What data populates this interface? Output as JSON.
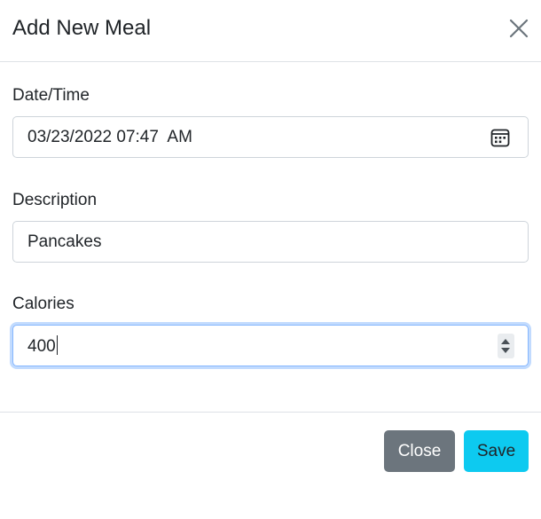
{
  "dialog": {
    "title": "Add New Meal"
  },
  "form": {
    "datetime": {
      "label": "Date/Time",
      "value": "03/23/2022 07:47  AM"
    },
    "description": {
      "label": "Description",
      "value": "Pancakes"
    },
    "calories": {
      "label": "Calories",
      "value": "400"
    }
  },
  "footer": {
    "close_label": "Close",
    "save_label": "Save"
  },
  "colors": {
    "close_button": "#6c757d",
    "save_button": "#0dcaf0",
    "focus_border": "#86b7fe",
    "divider": "#dee2e6"
  },
  "icons": {
    "close": "close-icon",
    "calendar": "calendar-icon",
    "spinner": "number-spinner"
  }
}
